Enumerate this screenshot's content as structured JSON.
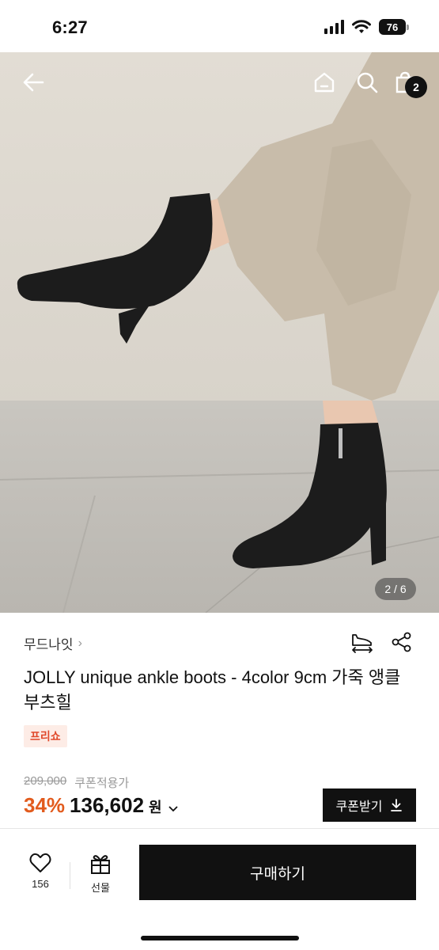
{
  "status_bar": {
    "time": "6:27",
    "battery": "76"
  },
  "header": {
    "cart_count": "2",
    "icons": [
      "back-arrow-icon",
      "home-icon",
      "search-icon",
      "shopping-bag-icon"
    ]
  },
  "gallery": {
    "indicator": "2 / 6"
  },
  "product": {
    "brand": "무드나잇",
    "title": "JOLLY unique ankle boots - 4color 9cm 가죽 앵클 부츠힐",
    "tag": "프리쇼",
    "original_price": "209,000",
    "coupon_price_label": "쿠폰적용가",
    "discount": "34%",
    "price": "136,602",
    "currency": "원"
  },
  "actions": {
    "coupon_button": "쿠폰받기",
    "like_count": "156",
    "gift_label": "선물",
    "buy_button": "구매하기"
  },
  "colors": {
    "accent_discount": "#e25b1d",
    "tag_text": "#e0492b",
    "tag_bg": "#fdece6",
    "button_black": "#111111"
  }
}
